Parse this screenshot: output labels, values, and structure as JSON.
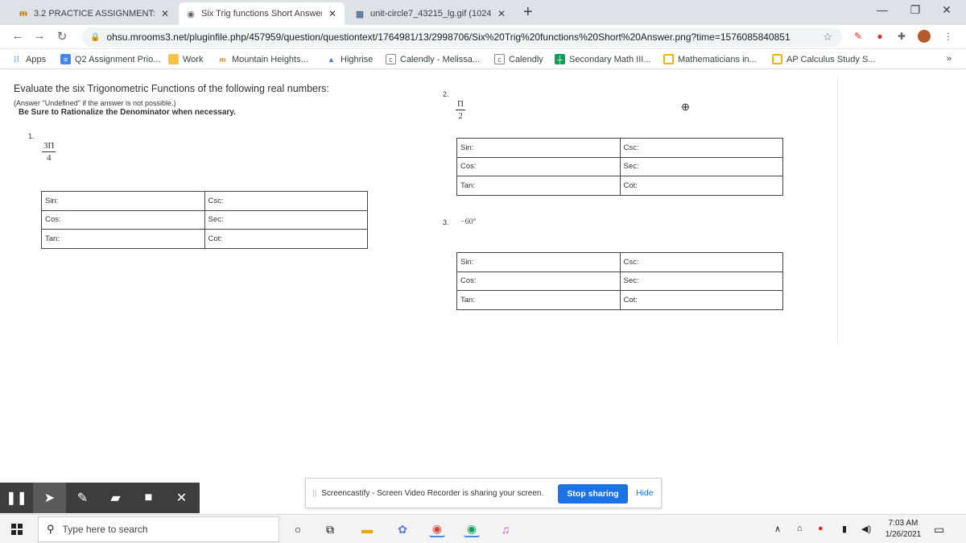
{
  "tabs": [
    {
      "title": "3.2 PRACTICE ASSIGNMENT: The",
      "icon": "mrooms-icon"
    },
    {
      "title": "Six Trig functions Short Answer.p",
      "icon": "page-icon"
    },
    {
      "title": "unit-circle7_43215_lg.gif (1024×1",
      "icon": "image-icon"
    }
  ],
  "url": "ohsu.mrooms3.net/pluginfile.php/457959/question/questiontext/1764981/13/2998706/Six%20Trig%20functions%20Short%20Answer.png?time=1576085840851",
  "bookmarks": [
    {
      "label": "Apps"
    },
    {
      "label": "Q2 Assignment Prio..."
    },
    {
      "label": "Work"
    },
    {
      "label": "Mountain Heights..."
    },
    {
      "label": "Highrise"
    },
    {
      "label": "Calendly - Melissa..."
    },
    {
      "label": "Calendly"
    },
    {
      "label": "Secondary Math III..."
    },
    {
      "label": "Mathematicians in..."
    },
    {
      "label": "AP Calculus Study S..."
    }
  ],
  "page": {
    "heading": "Evaluate the six Trigonometric Functions of the following real numbers:",
    "note1": "(Answer \"Undefined\" if the answer is not possible.)",
    "note2": "Be Sure to Rationalize the Denominator when necessary.",
    "q1": {
      "number": "1.",
      "numerator": "3Π",
      "denominator": "4"
    },
    "q2": {
      "number": "2.",
      "numerator": "Π",
      "denominator": "2"
    },
    "q3": {
      "number": "3.",
      "angle": "−60°"
    },
    "table_labels": {
      "sin": "Sin:",
      "csc": "Csc:",
      "cos": "Cos:",
      "sec": "Sec:",
      "tan": "Tan:",
      "cot": "Cot:"
    }
  },
  "screencastify": {
    "message": "Screencastify - Screen Video Recorder is sharing your screen.",
    "stop_label": "Stop sharing",
    "hide_label": "Hide"
  },
  "taskbar": {
    "search_placeholder": "Type here to search",
    "time": "7:03 AM",
    "date": "1/26/2021"
  }
}
